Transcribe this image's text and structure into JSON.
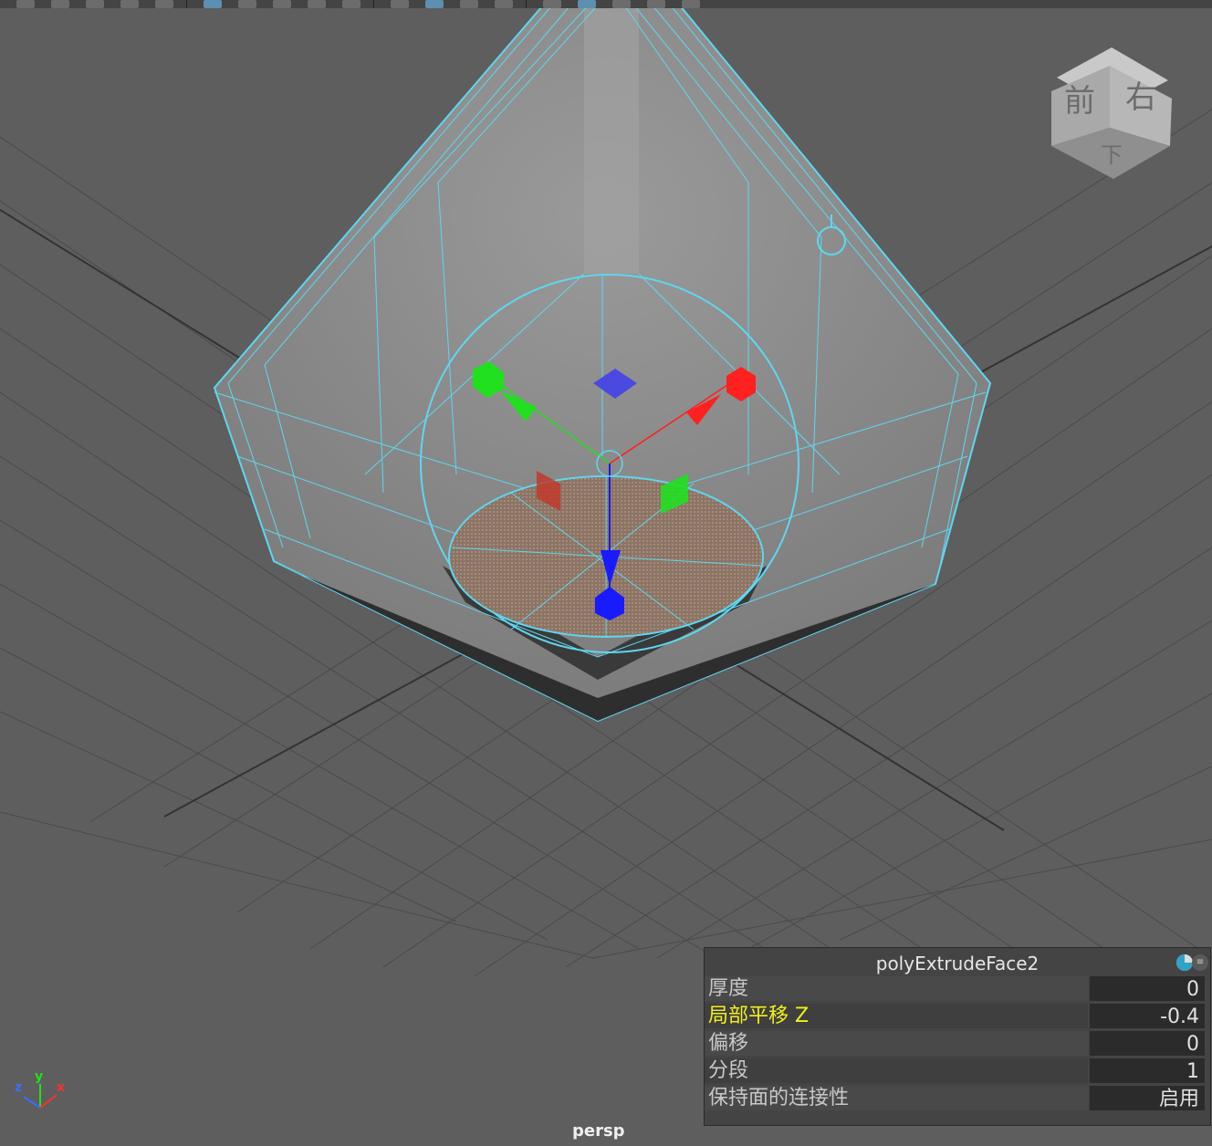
{
  "viewport": {
    "camera": "persp",
    "view_cube": {
      "front": "前",
      "right": "右",
      "bottom": "下"
    },
    "axis_triad": {
      "x": "x",
      "y": "y",
      "z": "z"
    }
  },
  "channel_box": {
    "node_name": "polyExtrudeFace2",
    "attributes": [
      {
        "label": "厚度",
        "value": "0",
        "highlighted": false
      },
      {
        "label": "局部平移 Z",
        "value": "-0.4",
        "highlighted": true
      },
      {
        "label": "偏移",
        "value": "0",
        "highlighted": false
      },
      {
        "label": "分段",
        "value": "1",
        "highlighted": false
      },
      {
        "label": "保持面的连接性",
        "value": "启用",
        "highlighted": false
      }
    ]
  },
  "colors": {
    "viewport_bg": "#5e5e5e",
    "wireframe": "#5fd6f0",
    "manip_x": "#ff2020",
    "manip_y": "#20e020",
    "manip_z": "#1a1aff",
    "highlight_text": "#f2f01a"
  },
  "toolbar": {
    "icons": [
      "select-icon",
      "move-icon",
      "snap-icon",
      "magnet-icon",
      "paint-icon",
      "camera-icon",
      "grid-icon",
      "film-icon",
      "shaded-icon",
      "wireframe-cube-icon",
      "textured-cube-icon",
      "light-icon",
      "shadow-icon",
      "isolate-icon",
      "xray-icon"
    ]
  }
}
